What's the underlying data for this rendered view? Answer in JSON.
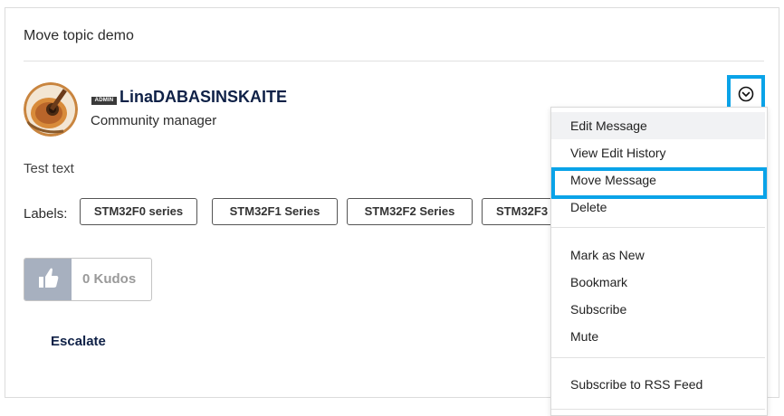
{
  "topic": {
    "title": "Move topic demo"
  },
  "author": {
    "badge": "ADMIN",
    "name": "LinaDABASINSKAITE",
    "role": "Community manager"
  },
  "message": {
    "body": "Test text"
  },
  "labels": {
    "caption": "Labels:",
    "items": [
      "STM32F0 series",
      "STM32F1 Series",
      "STM32F2 Series",
      "STM32F3"
    ]
  },
  "kudos": {
    "count_label": "0 Kudos"
  },
  "escalate": {
    "label": "Escalate"
  },
  "options_menu": {
    "items": [
      "Edit Message",
      "View Edit History",
      "Move Message",
      "Delete",
      "Mark as New",
      "Bookmark",
      "Subscribe",
      "Mute",
      "Subscribe to RSS Feed"
    ],
    "highlighted": "Move Message"
  },
  "colors": {
    "highlight": "#0aa3e8",
    "kudos_button": "#a7b0bf",
    "username": "#0f2147"
  },
  "icons": {
    "options_toggle": "chevron-down-circle-icon",
    "kudos": "thumbs-up-icon"
  }
}
